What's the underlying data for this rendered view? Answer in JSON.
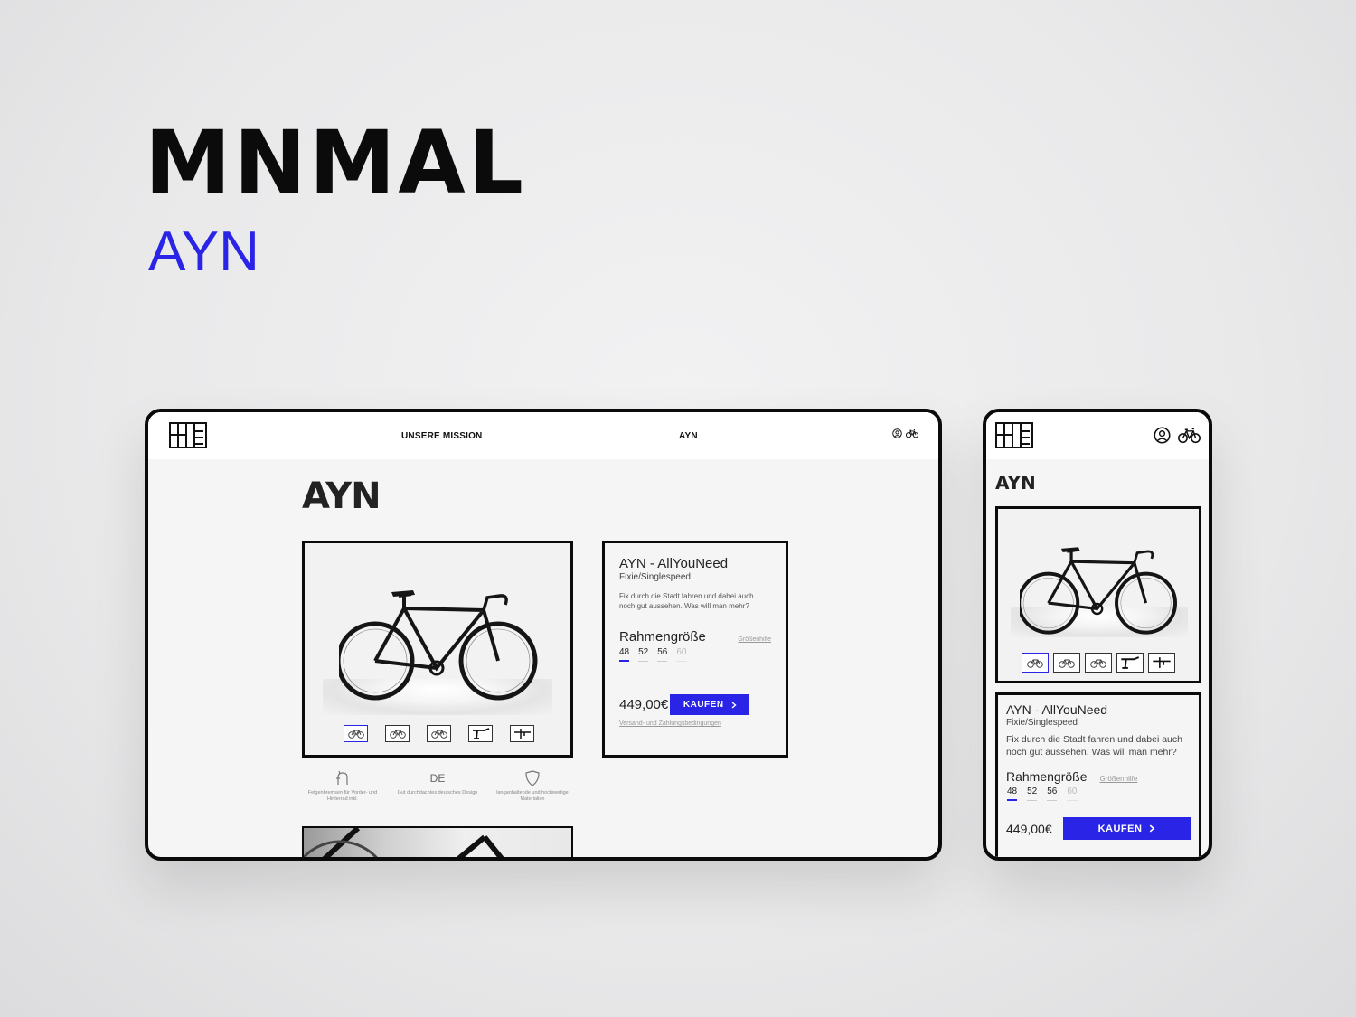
{
  "brand": {
    "title": "MNMAL",
    "subtitle": "AYN"
  },
  "colors": {
    "accent": "#2a24e6",
    "frame": "#0b0b0b",
    "background": "#ececed"
  },
  "desktop": {
    "nav": {
      "links": [
        "UNSERE MISSION",
        "AYN"
      ],
      "icons": [
        "user-icon",
        "bike-icon"
      ]
    },
    "heading": "AYN",
    "thumbnails": [
      "bike-full-thumb",
      "bike-angle-thumb",
      "bike-side-thumb",
      "handlebar-thumb",
      "frame-detail-thumb"
    ],
    "product": {
      "name": "AYN - AllYouNeed",
      "type": "Fixie/Singlespeed",
      "description": "Fix durch die Stadt fahren und dabei auch noch gut aussehen. Was will man mehr?",
      "size_title": "Rahmengröße",
      "size_help": "Größenhilfe",
      "sizes": [
        "48",
        "52",
        "56",
        "60"
      ],
      "selected_size": "48",
      "unavailable_size": "60",
      "price": "449,00€",
      "buy_label": "KAUFEN",
      "shipping": "Versand- und Zahlungsbedingungen"
    },
    "features": [
      {
        "icon": "brake-icon",
        "text": "Felgenbremsen für Vorder- und Hinterrad inkl."
      },
      {
        "icon": "de-label",
        "label": "DE",
        "text": "Gut durchdachtes deutsches Design"
      },
      {
        "icon": "shield-icon",
        "text": "langanhaltende und hochwertige Materialien"
      }
    ]
  },
  "mobile": {
    "heading": "AYN",
    "product": {
      "name": "AYN - AllYouNeed",
      "type": "Fixie/Singlespeed",
      "description": "Fix durch die Stadt fahren und dabei auch noch gut aussehen. Was will man mehr?",
      "size_title": "Rahmengröße",
      "size_help": "Größenhilfe",
      "sizes": [
        "48",
        "52",
        "56",
        "60"
      ],
      "price": "449,00€",
      "buy_label": "KAUFEN"
    }
  }
}
